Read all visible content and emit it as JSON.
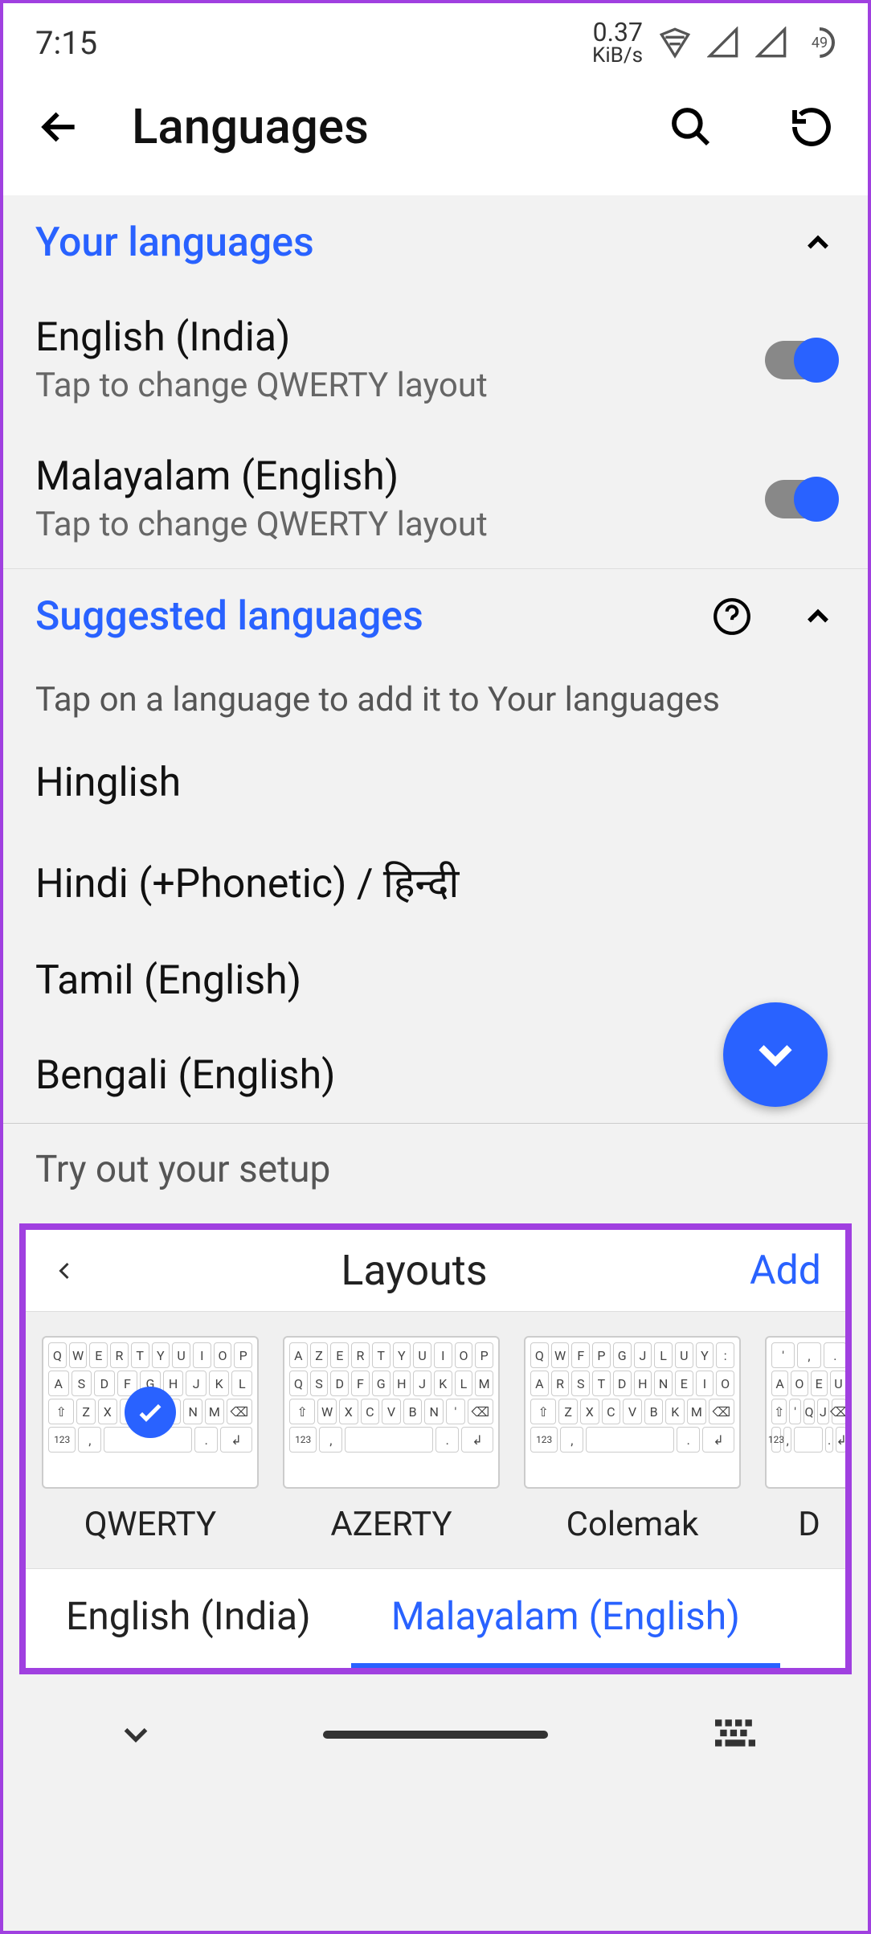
{
  "status": {
    "time": "7:15",
    "data_rate": "0.37",
    "data_unit": "KiB/s",
    "battery_pct": "49"
  },
  "appbar": {
    "title": "Languages"
  },
  "sections": {
    "your_languages_title": "Your languages",
    "suggested_title": "Suggested languages",
    "suggested_hint": "Tap on a language to add it to Your languages"
  },
  "your_languages": [
    {
      "name": "English (India)",
      "sub": "Tap to change QWERTY layout",
      "enabled": true
    },
    {
      "name": "Malayalam (English)",
      "sub": "Tap to change QWERTY layout",
      "enabled": true
    }
  ],
  "suggested": [
    "Hinglish",
    "Hindi (+Phonetic) / हिन्दी",
    "Tamil (English)",
    "Bengali (English)"
  ],
  "tryout_label": "Try out your setup",
  "layouts": {
    "title": "Layouts",
    "add_label": "Add",
    "items": [
      {
        "name": "QWERTY",
        "row1": "QWERTYUIOP",
        "row2": "ASDFGHJKL",
        "row3": "ZXCVBNM",
        "selected": true
      },
      {
        "name": "AZERTY",
        "row1": "AZERTYUIOP",
        "row2": "QSDFGHJKLM",
        "row3": "WXCVBN'",
        "selected": false
      },
      {
        "name": "Colemak",
        "row1": "QWFPGJLUY:",
        "row2": "ARSTDHNEIO",
        "row3": "ZXCVBKM",
        "selected": false
      },
      {
        "name": "D",
        "row1": "',.",
        "row2": "AOEU",
        "row3": "'QJ",
        "selected": false
      }
    ]
  },
  "tabs": [
    {
      "label": "English (India)",
      "active": false
    },
    {
      "label": "Malayalam (English)",
      "active": true
    }
  ]
}
